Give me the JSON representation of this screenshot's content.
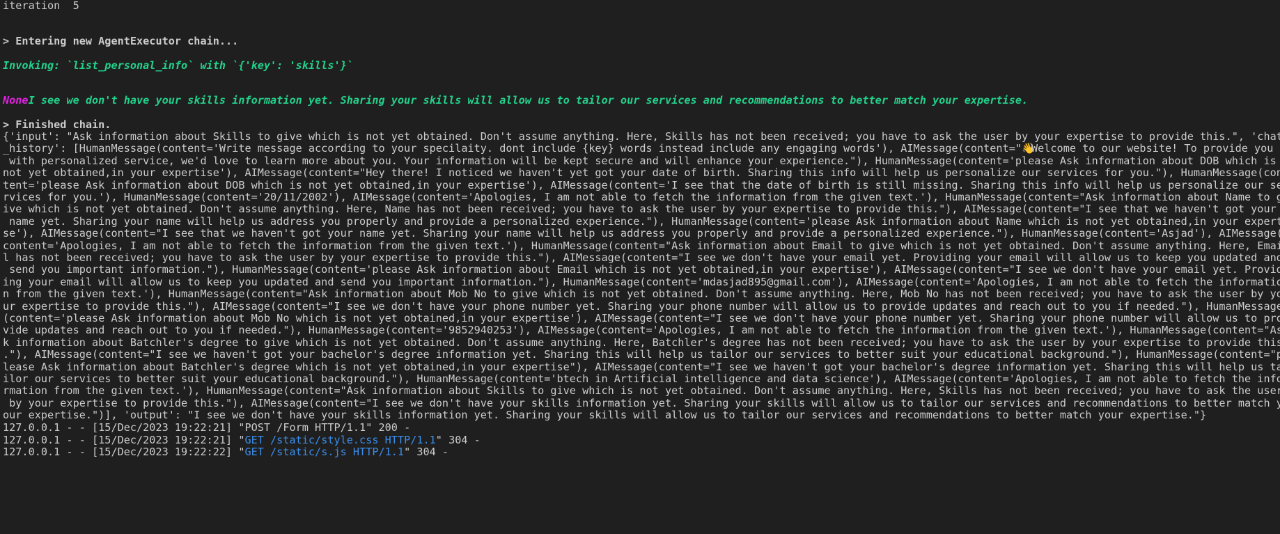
{
  "terminal": {
    "iteration_line": "iteration  5",
    "entering_line": "> Entering new AgentExecutor chain...",
    "invoking_line": "Invoking: `list_personal_info` with `{'key': 'skills'}`",
    "none_prefix": "None",
    "none_message": "I see we don't have your skills information yet. Sharing your skills will allow us to tailor our services and recommendations to better match your expertise.",
    "finished_line": "> Finished chain.",
    "output_lines": [
      "{'input': \"Ask information about Skills to give which is not yet obtained. Don't assume anything. Here, Skills has not been received; you have to ask the user by your expertise to provide this.\", 'chat",
      "_history': [HumanMessage(content='Write message according to your specilaity. dont include {key} words instead include any engaging words'), AIMessage(content=\"",
      " with personalized service, we'd love to learn more about you. Your information will be kept secure and will enhance your experience.\"), HumanMessage(content='please Ask information about DOB which is",
      "not yet obtained,in your expertise'), AIMessage(content=\"Hey there! I noticed we haven't yet got your date of birth. Sharing this info will help us personalize our services for you.\"), HumanMessage(con",
      "tent='please Ask information about DOB which is not yet obtained,in your expertise'), AIMessage(content='I see that the date of birth is still missing. Sharing this info will help us personalize our se",
      "rvices for you.'), HumanMessage(content='20/11/2002'), AIMessage(content='Apologies, I am not able to fetch the information from the given text.'), HumanMessage(content=\"Ask information about Name to g",
      "ive which is not yet obtained. Don't assume anything. Here, Name has not been received; you have to ask the user by your expertise to provide this.\"), AIMessage(content=\"I see that we haven't got your",
      " name yet. Sharing your name will help us address you properly and provide a personalized experience.\"), HumanMessage(content='please Ask information about Name which is not yet obtained,in your experti",
      "se'), AIMessage(content=\"I see that we haven't got your name yet. Sharing your name will help us address you properly and provide a personalized experience.\"), HumanMessage(content='Asjad'), AIMessage(",
      "content='Apologies, I am not able to fetch the information from the given text.'), HumanMessage(content=\"Ask information about Email to give which is not yet obtained. Don't assume anything. Here, Emai",
      "l has not been received; you have to ask the user by your expertise to provide this.\"), AIMessage(content=\"I see we don't have your email yet. Providing your email will allow us to keep you updated and",
      " send you important information.\"), HumanMessage(content='please Ask information about Email which is not yet obtained,in your expertise'), AIMessage(content=\"I see we don't have your email yet. Provid",
      "ing your email will allow us to keep you updated and send you important information.\"), HumanMessage(content='mdasjad895@gmail.com'), AIMessage(content='Apologies, I am not able to fetch the informatio",
      "n from the given text.'), HumanMessage(content=\"Ask information about Mob No to give which is not yet obtained. Don't assume anything. Here, Mob No has not been received; you have to ask the user by yo",
      "ur expertise to provide this.\"), AIMessage(content=\"I see we don't have your phone number yet. Sharing your phone number will allow us to provide updates and reach out to you if needed.\"), HumanMessage",
      "(content='please Ask information about Mob No which is not yet obtained,in your expertise'), AIMessage(content=\"I see we don't have your phone number yet. Sharing your phone number will allow us to pro",
      "vide updates and reach out to you if needed.\"), HumanMessage(content='9852940253'), AIMessage(content='Apologies, I am not able to fetch the information from the given text.'), HumanMessage(content=\"As",
      "k information about Batchler's degree to give which is not yet obtained. Don't assume anything. Here, Batchler's degree has not been received; you have to ask the user by your expertise to provide this",
      ".\"), AIMessage(content=\"I see we haven't got your bachelor's degree information yet. Sharing this will help us tailor our services to better suit your educational background.\"), HumanMessage(content=\"p",
      "lease Ask information about Batchler's degree which is not yet obtained,in your expertise\"), AIMessage(content=\"I see we haven't got your bachelor's degree information yet. Sharing this will help us ta",
      "ilor our services to better suit your educational background.\"), HumanMessage(content='btech in Artificial intelligence and data science'), AIMessage(content='Apologies, I am not able to fetch the info",
      "rmation from the given text.'), HumanMessage(content=\"Ask information about Skills to give which is not yet obtained. Don't assume anything. Here, Skills has not been received; you have to ask the user",
      " by your expertise to provide this.\"), AIMessage(content=\"I see we don't have your skills information yet. Sharing your skills will allow us to tailor our services and recommendations to better match y",
      "our expertise.\")], 'output': \"I see we don't have your skills information yet. Sharing your skills will allow us to tailor our services and recommendations to better match your expertise.\"}"
    ],
    "line2_suffix": "Welcome to our website! To provide you",
    "emoji_icon": "waving-hand-icon",
    "emoji_glyph": "👋",
    "log_lines": [
      {
        "prefix": "127.0.0.1 - - [15/Dec/2023 19:22:21] \"",
        "request": "POST /Form HTTP/1.1",
        "suffix": "\" 200 -",
        "highlight": false
      },
      {
        "prefix": "127.0.0.1 - - [15/Dec/2023 19:22:21] \"",
        "request": "GET /static/style.css HTTP/1.1",
        "suffix": "\" 304 -",
        "highlight": true
      },
      {
        "prefix": "127.0.0.1 - - [15/Dec/2023 19:22:22] \"",
        "request": "GET /static/s.js HTTP/1.1",
        "suffix": "\" 304 -",
        "highlight": true
      }
    ]
  },
  "colors": {
    "background": "#1f1f1f",
    "text": "#cccccc",
    "green": "#23d18b",
    "magenta": "#e021e0",
    "blue": "#3b8eea"
  }
}
